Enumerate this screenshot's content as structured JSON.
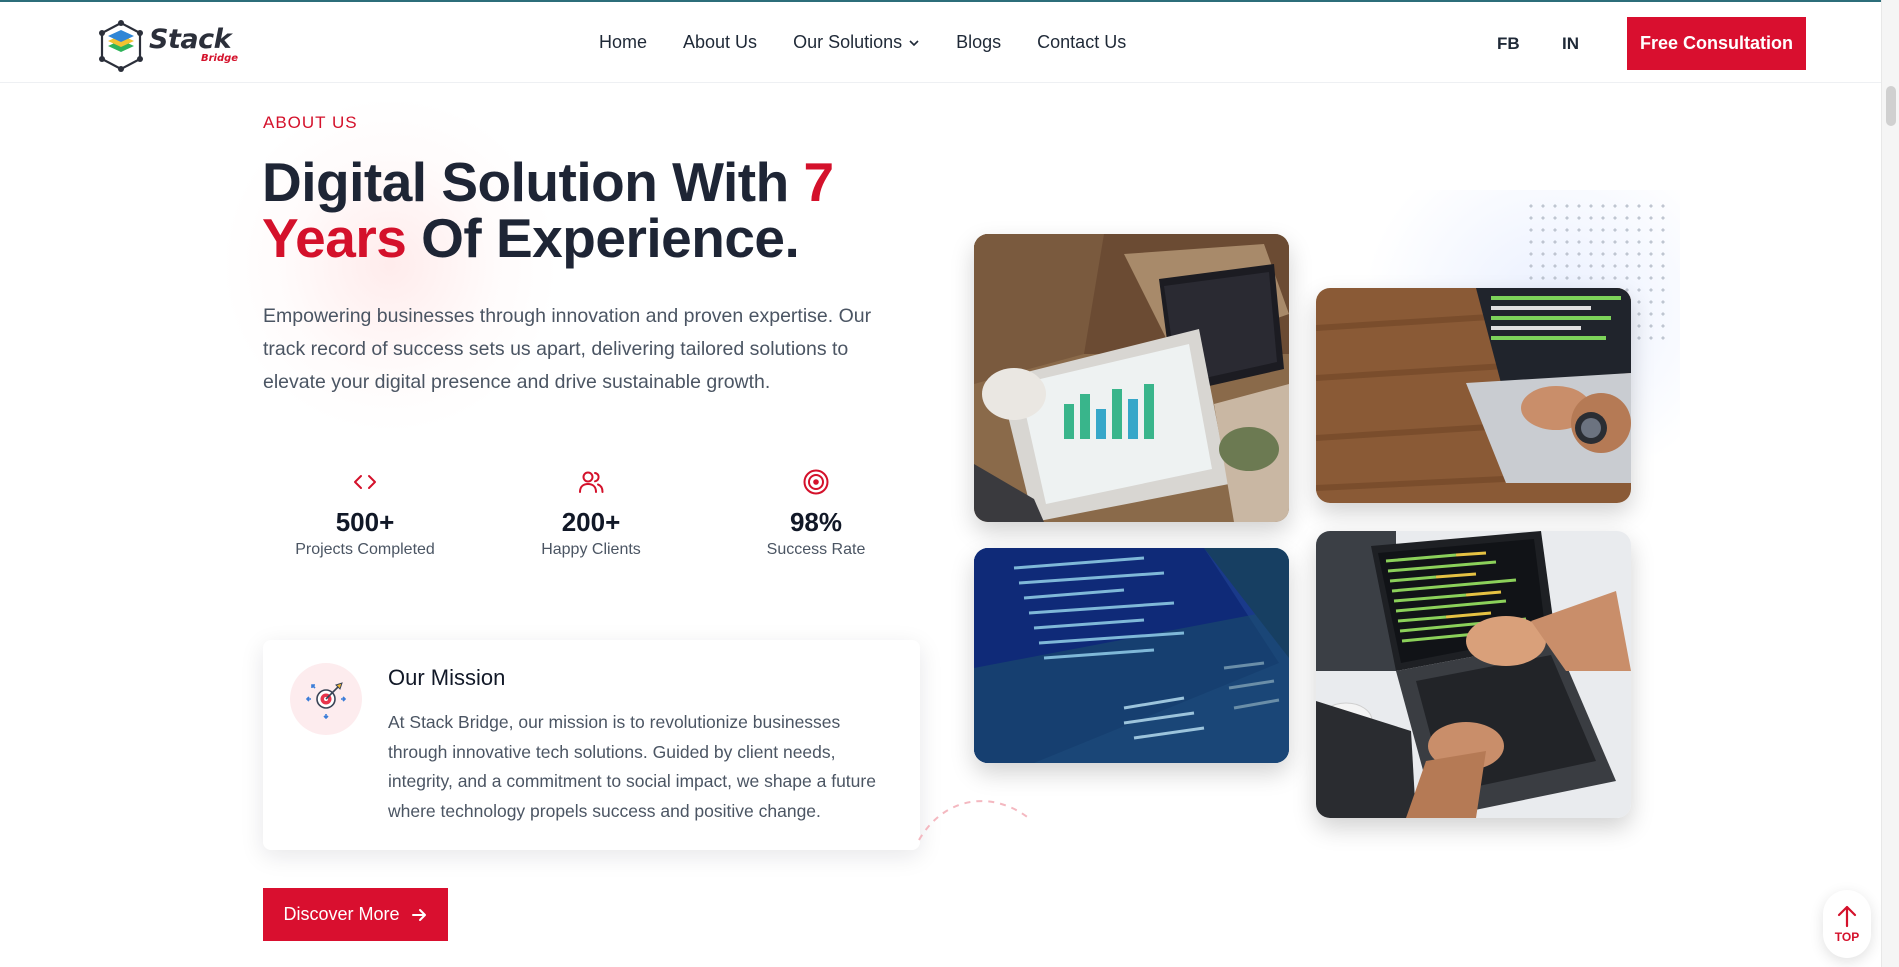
{
  "header": {
    "logo": {
      "name": "Stack",
      "sub": "Bridge"
    },
    "nav": [
      "Home",
      "About Us",
      "Our Solutions",
      "Blogs",
      "Contact Us"
    ],
    "social": {
      "fb": "FB",
      "in": "IN"
    },
    "cta": "Free Consultation"
  },
  "hero": {
    "eyebrow": "ABOUT US",
    "headline_a": "Digital Solution With ",
    "headline_num": "7",
    "headline_years": "Years",
    "headline_b": " Of Experience.",
    "description": "Empowering businesses through innovation and proven expertise. Our track record of success sets us apart, delivering tailored solutions to elevate your digital presence and drive sustainable growth."
  },
  "stats": [
    {
      "icon": "code-icon",
      "value": "500+",
      "label": "Projects Completed"
    },
    {
      "icon": "users-icon",
      "value": "200+",
      "label": "Happy Clients"
    },
    {
      "icon": "target-icon",
      "value": "98%",
      "label": "Success Rate"
    }
  ],
  "mission": {
    "title": "Our Mission",
    "text": "At Stack Bridge, our mission is to revolutionize businesses through innovative tech solutions. Guided by client needs, integrity, and a commitment to social impact, we shape a future where technology propels success and positive change."
  },
  "discover": {
    "label": "Discover More"
  },
  "back_to_top": {
    "label": "TOP"
  },
  "colors": {
    "accent": "#d90f2f",
    "heading": "#1e2535",
    "body": "#4b5563"
  }
}
